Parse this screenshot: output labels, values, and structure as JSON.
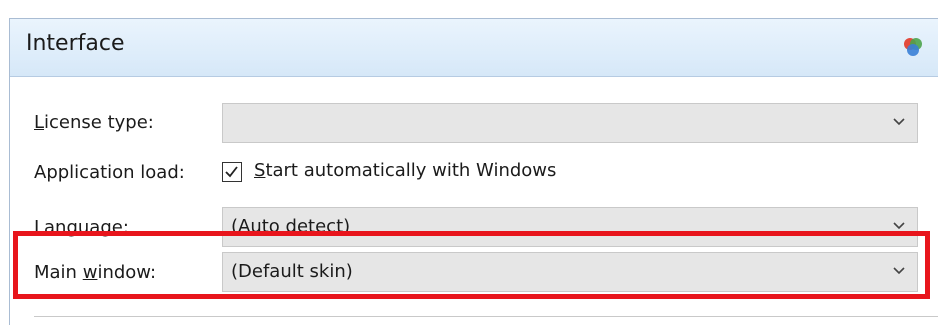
{
  "header": {
    "title": "Interface",
    "icon": "app-logo-icon"
  },
  "fields": {
    "license_type": {
      "label_ul": "L",
      "label_rest": "icense type:",
      "value": ""
    },
    "application_load": {
      "label": "Application load:",
      "checkbox_checked": true,
      "checkbox_label_ul": "S",
      "checkbox_label_rest": "tart automatically with Windows"
    },
    "language": {
      "label": "Language:",
      "value": "(Auto detect)"
    },
    "main_window": {
      "label_pre": "Main ",
      "label_ul": "w",
      "label_rest": "indow:",
      "value": "(Default skin)"
    }
  },
  "highlight_color": "#e8151c"
}
